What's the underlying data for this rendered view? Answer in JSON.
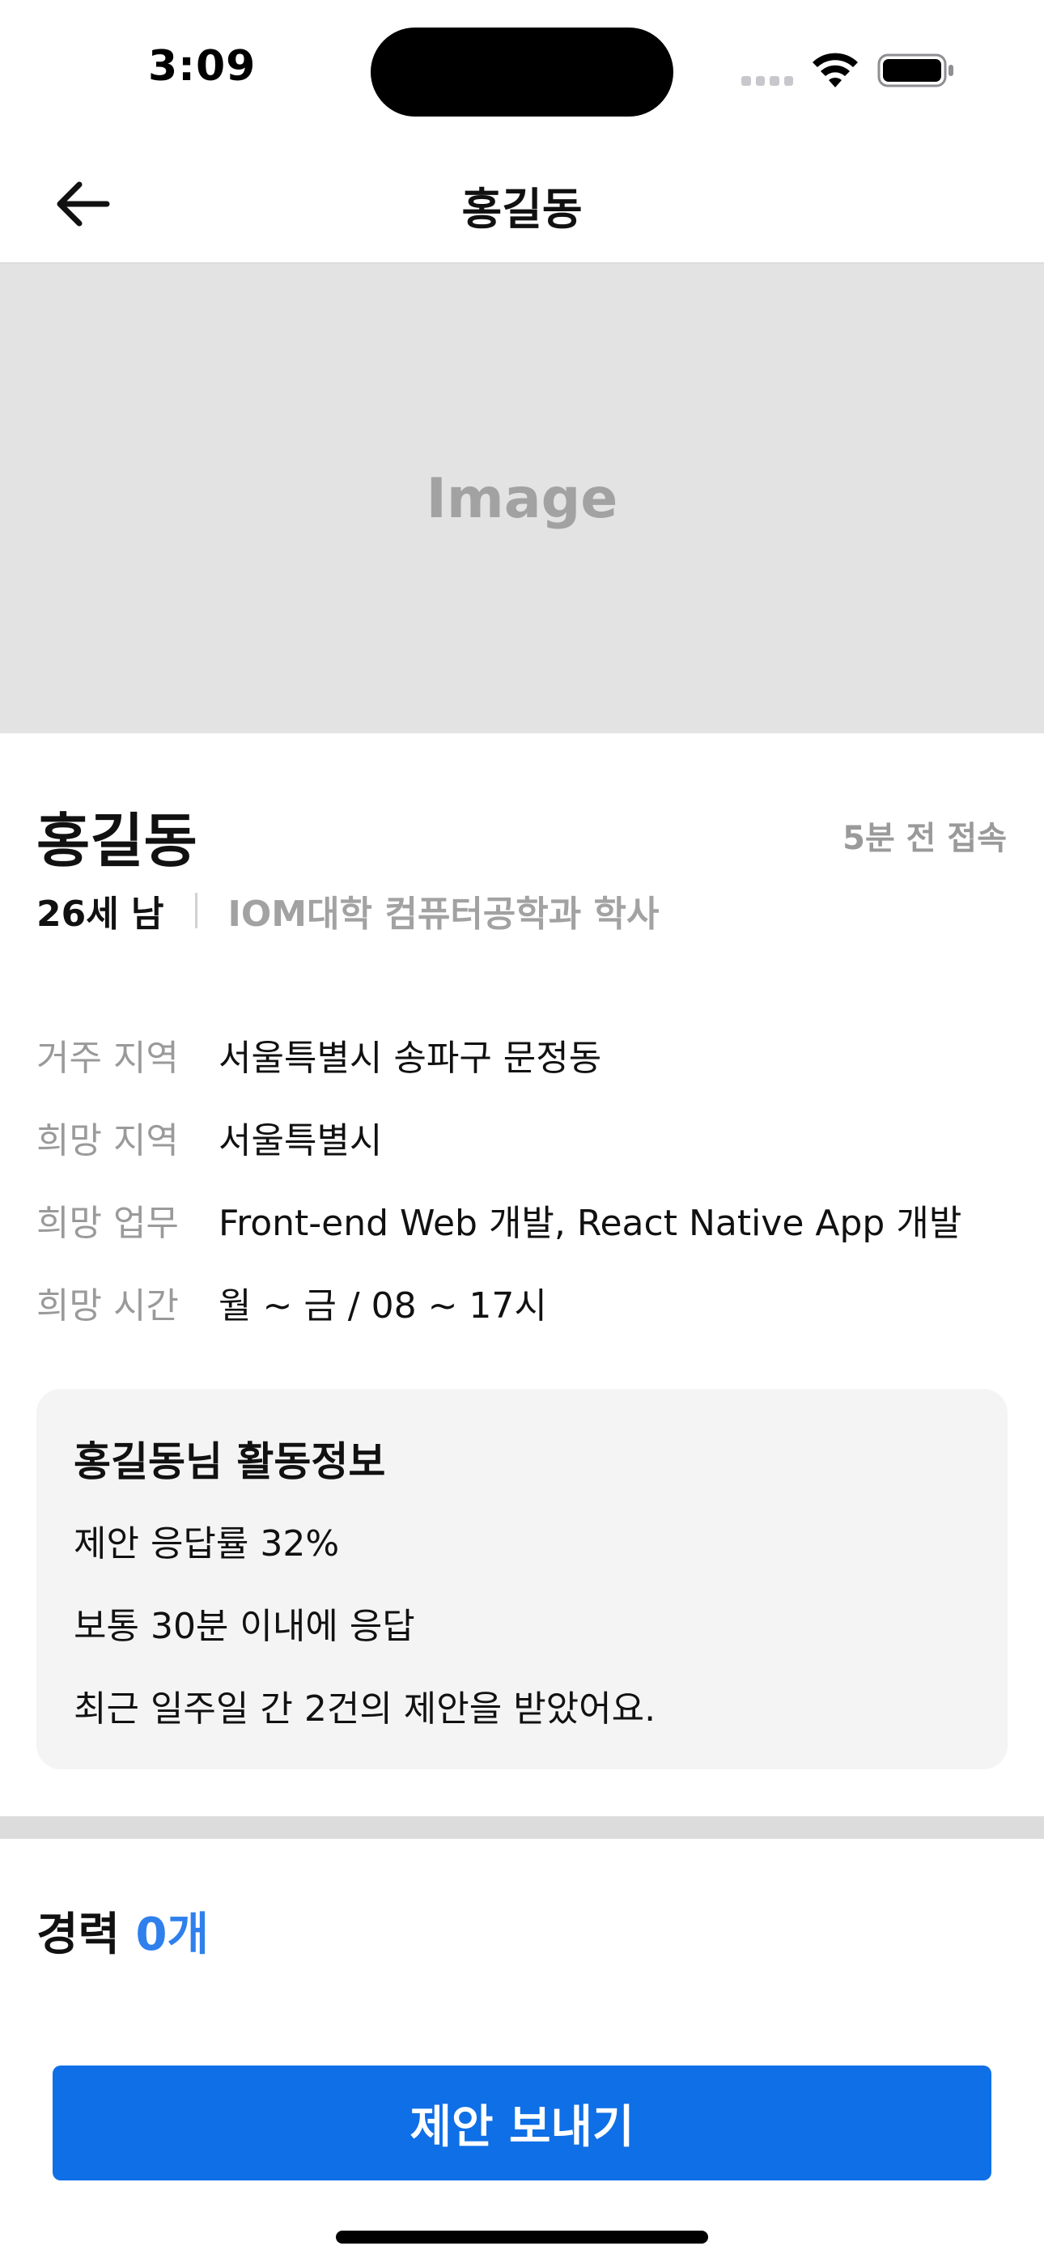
{
  "status_bar": {
    "time": "3:09"
  },
  "header": {
    "title": "홍길동"
  },
  "hero": {
    "placeholder_label": "Image"
  },
  "profile": {
    "name": "홍길동",
    "last_access": "5분 전 접속",
    "age_gender": "26세 남",
    "education": "IOM대학 컴퓨터공학과 학사"
  },
  "info_rows": [
    {
      "label": "거주 지역",
      "value": "서울특별시 송파구 문정동"
    },
    {
      "label": "희망 지역",
      "value": "서울특별시"
    },
    {
      "label": "희망 업무",
      "value": "Front-end Web 개발, React Native App 개발"
    },
    {
      "label": "희망 시간",
      "value": "월 ~ 금 / 08 ~ 17시"
    }
  ],
  "activity": {
    "title": "홍길동님 활동정보",
    "lines": [
      "제안 응답률 32%",
      "보통 30분 이내에 응답",
      "최근 일주일 간 2건의 제안을 받았어요."
    ]
  },
  "career": {
    "label": "경력",
    "count": "0개"
  },
  "cta": {
    "label": "제안 보내기"
  },
  "colors": {
    "primary": "#0f6fe6",
    "accent_text": "#2f80ed",
    "muted_text": "#9a9a9a",
    "card_bg": "#f4f4f4",
    "image_bg": "#e3e3e3"
  },
  "icons": {
    "back": "arrow-left-icon",
    "wifi": "wifi-icon",
    "battery": "battery-icon"
  }
}
